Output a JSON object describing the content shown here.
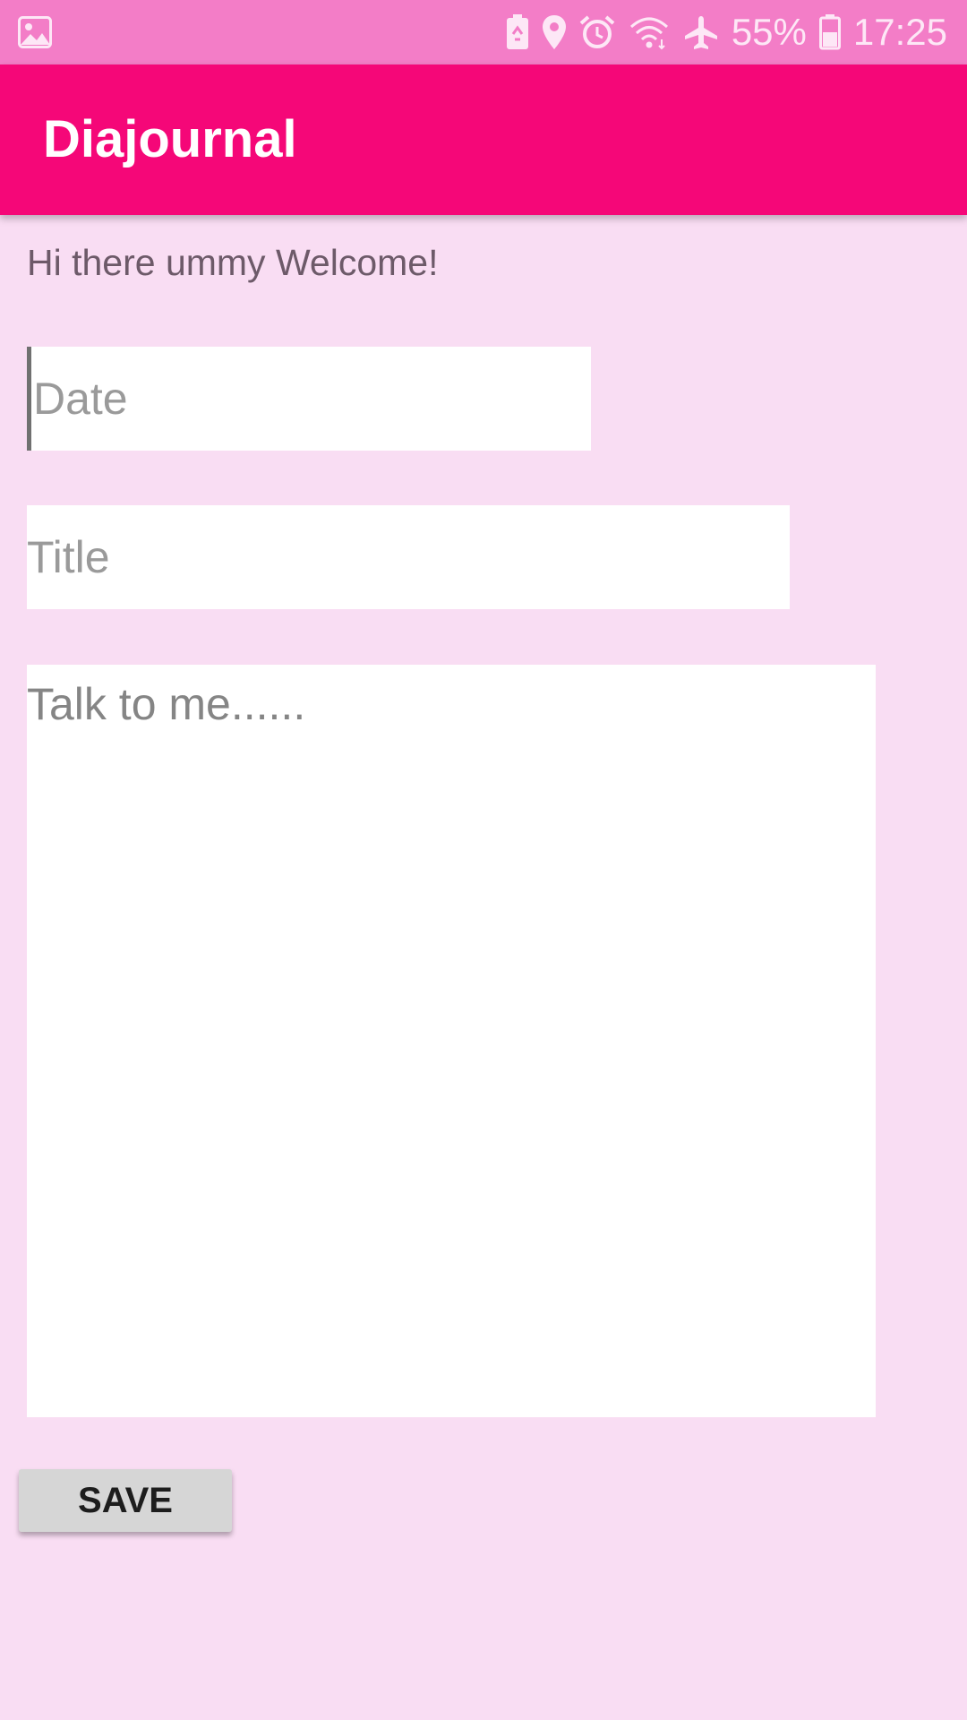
{
  "status_bar": {
    "icons_left": [
      "gallery-icon"
    ],
    "icons_right": [
      "battery-saver-icon",
      "location-icon",
      "alarm-icon",
      "wifi-icon",
      "airplane-mode-icon",
      "battery-icon"
    ],
    "battery": "55%",
    "time": "17:25"
  },
  "app_bar": {
    "title": "Diajournal"
  },
  "main": {
    "welcome_text": "Hi there ummy Welcome!",
    "date_placeholder": "Date",
    "date_value": "",
    "title_placeholder": "Title",
    "title_value": "",
    "body_placeholder": "Talk to me......",
    "body_value": "",
    "save_label": "SAVE"
  },
  "colors": {
    "status_bar": "#f37dc7",
    "app_bar": "#f50778",
    "background": "#f9ddf3",
    "button": "#d6d6d6"
  }
}
